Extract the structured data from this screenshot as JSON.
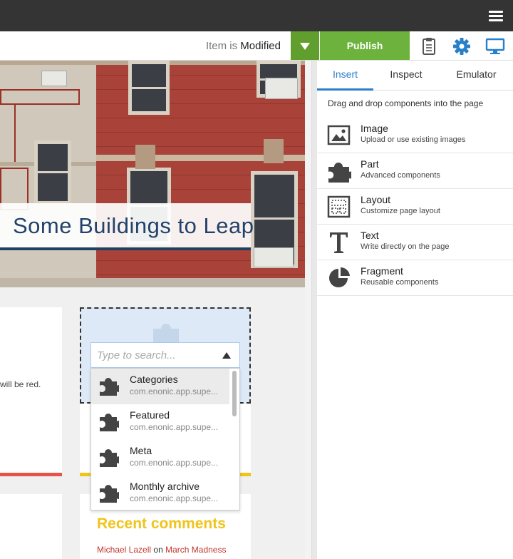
{
  "toolbar": {
    "status_prefix": "Item is",
    "status_value": "Modified",
    "publish_label": "Publish"
  },
  "preview": {
    "hero_title": "Some Buildings to Leap",
    "card_text": "will be red.",
    "search_placeholder": "Type to search...",
    "parts": [
      {
        "name": "Categories",
        "app": "com.enonic.app.supe..."
      },
      {
        "name": "Featured",
        "app": "com.enonic.app.supe..."
      },
      {
        "name": "Meta",
        "app": "com.enonic.app.supe..."
      },
      {
        "name": "Monthly archive",
        "app": "com.enonic.app.supe..."
      }
    ],
    "recent_title": "Recent comments",
    "recent_author": "Michael Lazell",
    "recent_on": "on",
    "recent_post": "March Madness"
  },
  "panel": {
    "tabs": [
      "Insert",
      "Inspect",
      "Emulator"
    ],
    "hint": "Drag and drop components into the page",
    "components": [
      {
        "name": "Image",
        "desc": "Upload or use existing images",
        "icon": "image-icon"
      },
      {
        "name": "Part",
        "desc": "Advanced components",
        "icon": "puzzle-icon"
      },
      {
        "name": "Layout",
        "desc": "Customize page layout",
        "icon": "layout-icon"
      },
      {
        "name": "Text",
        "desc": "Write directly on the page",
        "icon": "text-icon"
      },
      {
        "name": "Fragment",
        "desc": "Reusable components",
        "icon": "pie-icon"
      }
    ]
  },
  "colors": {
    "publish_green": "#6db23c",
    "publish_dropdown_green": "#609e2e",
    "accent_blue": "#2a7fc9",
    "topbar": "#343434"
  }
}
